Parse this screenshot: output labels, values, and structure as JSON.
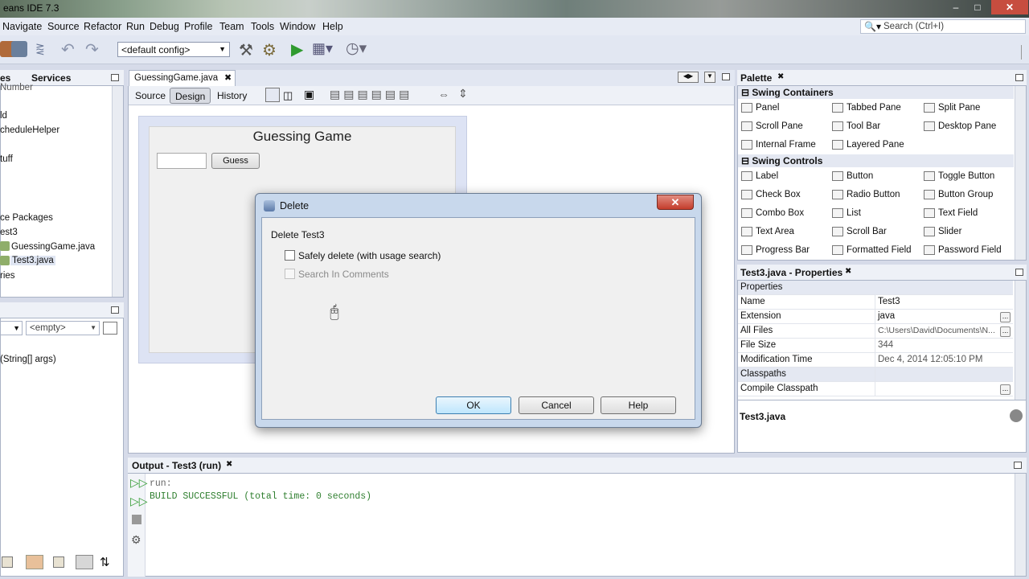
{
  "window": {
    "title": "eans IDE 7.3"
  },
  "menu": {
    "items": [
      "Navigate",
      "Source",
      "Refactor",
      "Run",
      "Debug",
      "Profile",
      "Team",
      "Tools",
      "Window",
      "Help"
    ]
  },
  "search": {
    "placeholder": "Search (Ctrl+I)"
  },
  "toolbar": {
    "config_value": "<default config>"
  },
  "left_panel": {
    "tabs": [
      "es",
      "Services"
    ],
    "tree": [
      "Number",
      "ld",
      "cheduleHelper",
      "tuff",
      "ce Packages",
      "est3",
      "GuessingGame.java",
      "Test3.java",
      "ries"
    ],
    "nav_select": "<empty>",
    "nav_item": "(String[] args)"
  },
  "editor": {
    "tab_label": "GuessingGame.java",
    "view_buttons": [
      "Source",
      "Design",
      "History"
    ],
    "form": {
      "title": "Guessing Game",
      "button": "Guess"
    }
  },
  "dialog": {
    "title": "Delete",
    "heading": "Delete Test3",
    "option_safe": "Safely delete (with usage search)",
    "option_comments": "Search In Comments",
    "buttons": {
      "ok": "OK",
      "cancel": "Cancel",
      "help": "Help"
    }
  },
  "palette": {
    "title": "Palette",
    "sections": [
      {
        "name": "Swing Containers",
        "items": [
          "Panel",
          "Tabbed Pane",
          "Split Pane",
          "Scroll Pane",
          "Tool Bar",
          "Desktop Pane",
          "Internal Frame",
          "Layered Pane"
        ]
      },
      {
        "name": "Swing Controls",
        "items": [
          "Label",
          "Button",
          "Toggle Button",
          "Check Box",
          "Radio Button",
          "Button Group",
          "Combo Box",
          "List",
          "Text Field",
          "Text Area",
          "Scroll Bar",
          "Slider",
          "Progress Bar",
          "Formatted Field",
          "Password Field"
        ]
      }
    ]
  },
  "properties": {
    "title": "Test3.java - Properties",
    "section1": "Properties",
    "rows": [
      {
        "name": "Name",
        "value": "Test3"
      },
      {
        "name": "Extension",
        "value": "java"
      },
      {
        "name": "All Files",
        "value": "C:\\Users\\David\\Documents\\N..."
      },
      {
        "name": "File Size",
        "value": "344"
      },
      {
        "name": "Modification Time",
        "value": "Dec 4, 2014 12:05:10 PM"
      }
    ],
    "section2": "Classpaths",
    "row_cp": "Compile Classpath",
    "footer": "Test3.java"
  },
  "output": {
    "title": "Output - Test3 (run)",
    "lines": [
      "run:",
      "BUILD SUCCESSFUL (total time: 0 seconds)"
    ]
  }
}
